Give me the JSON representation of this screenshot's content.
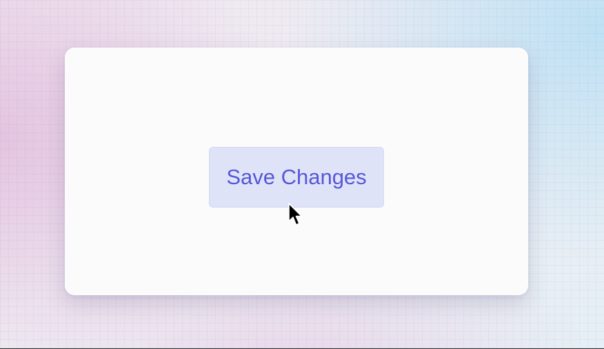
{
  "card": {
    "button": {
      "label": "Save Changes"
    }
  },
  "cursor": {
    "icon": "arrow-pointer-icon"
  },
  "colors": {
    "button_text": "#5558d6",
    "button_background": "#dfe3f8",
    "card_background": "#fbfbfc"
  }
}
